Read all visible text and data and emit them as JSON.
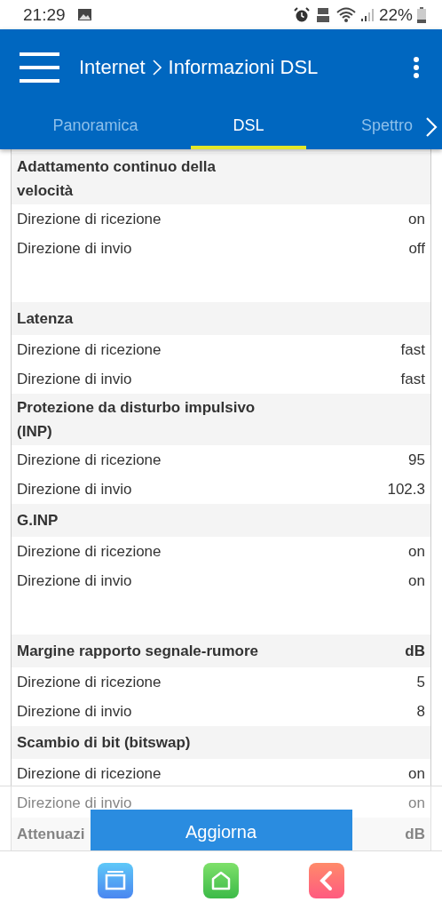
{
  "status_bar": {
    "time": "21:29",
    "battery": "22%"
  },
  "app_bar": {
    "breadcrumb": [
      "Internet",
      "Informazioni DSL"
    ]
  },
  "tabs": [
    {
      "label": "Panoramica",
      "selected": false
    },
    {
      "label": "DSL",
      "selected": true
    },
    {
      "label": "Spettro",
      "selected": false
    }
  ],
  "sections": [
    {
      "kind": "section",
      "title": "Adattamento continuo della velocità",
      "rows": [
        {
          "label": "Direzione di ricezione",
          "value": "on"
        },
        {
          "label": "Direzione di invio",
          "value": "off"
        }
      ]
    },
    {
      "kind": "spacer"
    },
    {
      "kind": "section",
      "title": "Latenza",
      "rows": [
        {
          "label": "Direzione di ricezione",
          "value": "fast"
        },
        {
          "label": "Direzione di invio",
          "value": "fast"
        }
      ]
    },
    {
      "kind": "section",
      "title": "Protezione da disturbo impulsivo (INP)",
      "rows": [
        {
          "label": "Direzione di ricezione",
          "value": "95"
        },
        {
          "label": "Direzione di invio",
          "value": "102.3"
        }
      ]
    },
    {
      "kind": "section",
      "title": "G.INP",
      "rows": [
        {
          "label": "Direzione di ricezione",
          "value": "on"
        },
        {
          "label": "Direzione di invio",
          "value": "on"
        }
      ]
    },
    {
      "kind": "spacer"
    },
    {
      "kind": "section",
      "title": "Margine rapporto segnale-rumore",
      "unit": "dB",
      "rows": [
        {
          "label": "Direzione di ricezione",
          "value": "5"
        },
        {
          "label": "Direzione di invio",
          "value": "8"
        }
      ]
    },
    {
      "kind": "section",
      "title": "Scambio di bit (bitswap)",
      "rows": [
        {
          "label": "Direzione di ricezione",
          "value": "on"
        },
        {
          "label": "Direzione di invio",
          "value": "on"
        }
      ]
    },
    {
      "kind": "section",
      "title": "Attenuazi",
      "unit": "dB"
    }
  ],
  "refresh_button": "Aggiorna"
}
